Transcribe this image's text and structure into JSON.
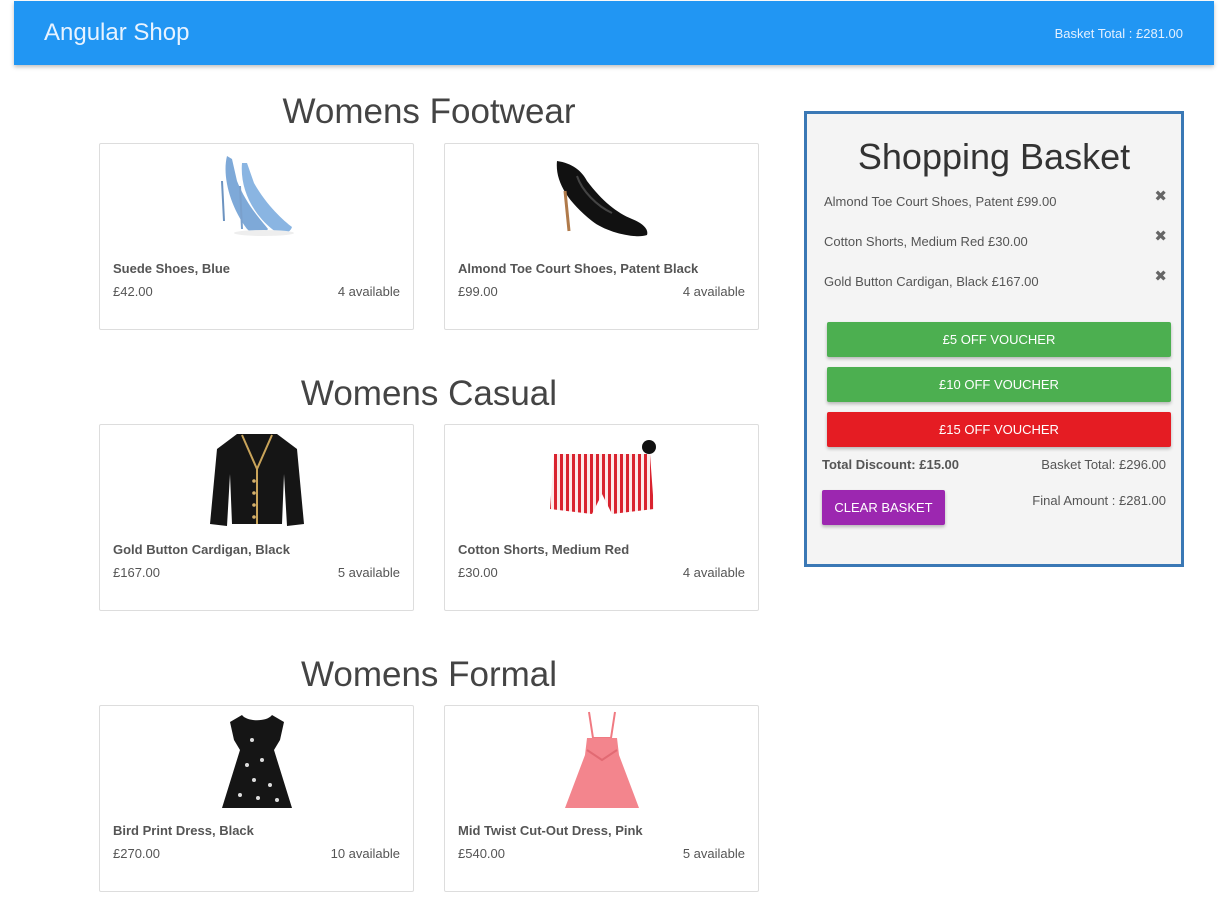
{
  "navbar": {
    "brand": "Angular Shop",
    "basket_total": "Basket Total : £281.00"
  },
  "sections": [
    {
      "title": "Womens Footwear",
      "products": [
        {
          "name": "Suede Shoes, Blue",
          "price": "£42.00",
          "stock": "4 available",
          "icon": "blue-heel-shoe-icon"
        },
        {
          "name": "Almond Toe Court Shoes, Patent Black",
          "price": "£99.00",
          "stock": "4 available",
          "icon": "black-court-shoe-icon"
        }
      ]
    },
    {
      "title": "Womens Casual",
      "products": [
        {
          "name": "Gold Button Cardigan, Black",
          "price": "£167.00",
          "stock": "5 available",
          "icon": "black-cardigan-icon"
        },
        {
          "name": "Cotton Shorts, Medium Red",
          "price": "£30.00",
          "stock": "4 available",
          "icon": "striped-shorts-icon"
        }
      ]
    },
    {
      "title": "Womens Formal",
      "products": [
        {
          "name": "Bird Print Dress, Black",
          "price": "£270.00",
          "stock": "10 available",
          "icon": "black-dress-icon"
        },
        {
          "name": "Mid Twist Cut-Out Dress, Pink",
          "price": "£540.00",
          "stock": "5 available",
          "icon": "pink-dress-icon"
        }
      ]
    }
  ],
  "basket": {
    "title": "Shopping Basket",
    "items": [
      {
        "label": "Almond Toe Court Shoes, Patent  £99.00",
        "remove": "✖"
      },
      {
        "label": "Cotton Shorts, Medium Red  £30.00",
        "remove": "✖"
      },
      {
        "label": "Gold Button Cardigan, Black  £167.00",
        "remove": "✖"
      }
    ],
    "vouchers": [
      {
        "label": "£5 OFF VOUCHER",
        "color": "#4caf50"
      },
      {
        "label": "£10 OFF VOUCHER",
        "color": "#4caf50"
      },
      {
        "label": "£15 OFF VOUCHER",
        "color": "#e51c23"
      }
    ],
    "total_discount": "Total Discount: £15.00",
    "basket_total": "Basket Total: £296.00",
    "clear_label": "CLEAR BASKET",
    "final_amount": "Final Amount : £281.00"
  },
  "colors": {
    "navbar": "#2196f3",
    "basket_border": "#3a78b5",
    "clear_button": "#9c27b0"
  }
}
